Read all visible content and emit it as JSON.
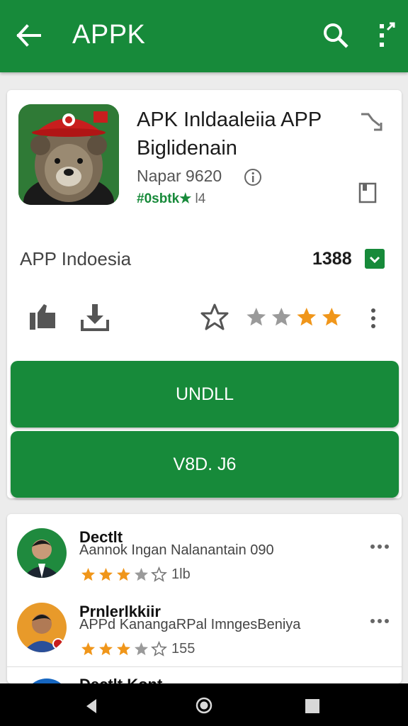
{
  "app_bar": {
    "title": "APPK"
  },
  "app": {
    "title": "APK Inldaaleiia APP Biglidenain",
    "publisher": "Napar 9620",
    "rating_label": "#0sbtk★",
    "rating_count": "l4",
    "developer": "APP Indoesia",
    "price": "1388"
  },
  "rating_big": 4,
  "buttons": {
    "primary": "UNDLL",
    "secondary": "V8D. J6"
  },
  "reviews": [
    {
      "name": "Dectlt",
      "text": "Aannok Ingan Nalanantain 090",
      "stars": 3.5,
      "count": "1lb"
    },
    {
      "name": "Prnlerlkkiir",
      "text": "APPd KanangaRPal ImngesBeniya",
      "stars": 3.5,
      "count": "155"
    },
    {
      "name": "Dectlt Kont"
    }
  ],
  "colors": {
    "primary": "#178a3a",
    "star": "#f0961a",
    "star_empty": "#9a9a9a"
  },
  "icons": [
    "back-arrow-icon",
    "search-icon",
    "more-vert-icon",
    "info-icon",
    "share-icon",
    "bookmark-icon",
    "thumbs-up-icon",
    "download-icon",
    "star-outline-icon",
    "nav-back-icon",
    "nav-home-icon",
    "nav-recent-icon"
  ]
}
